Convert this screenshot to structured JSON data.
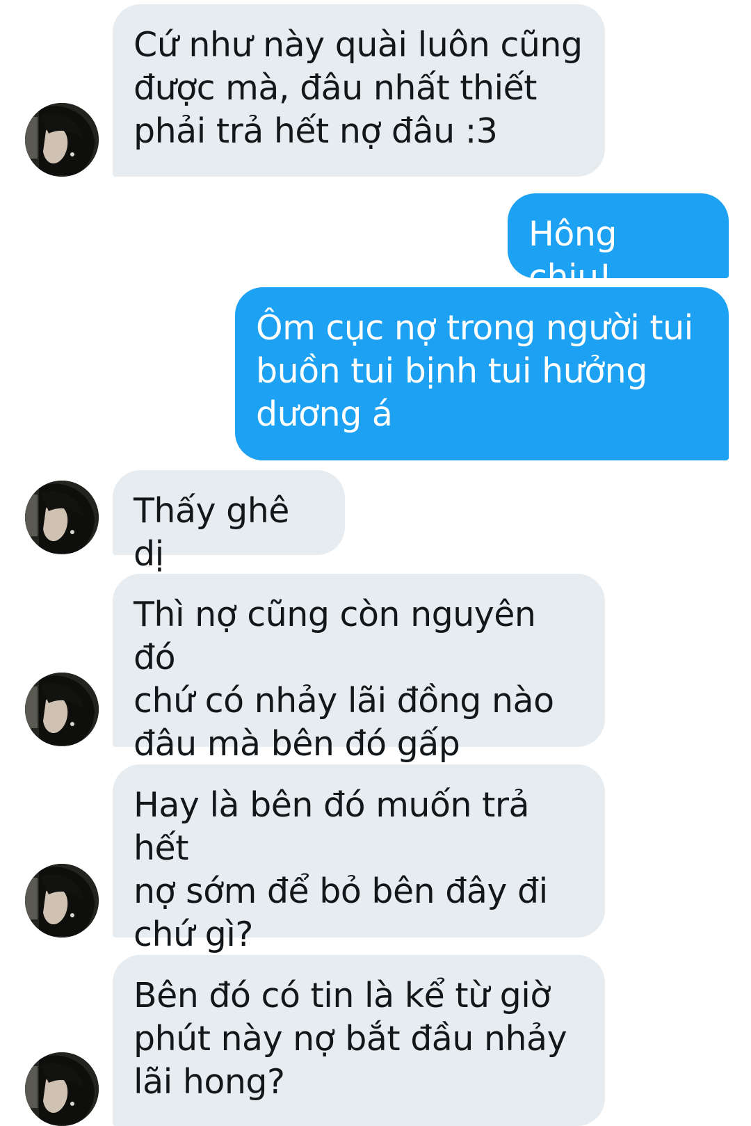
{
  "conversation": {
    "messages": [
      {
        "direction": "incoming",
        "text": "Cứ như này quài luôn cũng\nđược mà, đâu nhất thiết\nphải trả hết nợ đâu :3",
        "avatar": "contact-avatar"
      },
      {
        "direction": "outgoing",
        "text": "Hông chịu!"
      },
      {
        "direction": "outgoing",
        "text": "Ôm cục nợ trong người tui\nbuồn tui bịnh tui hưởng\ndương á"
      },
      {
        "direction": "incoming",
        "text": "Thấy ghê dị",
        "avatar": "contact-avatar"
      },
      {
        "direction": "incoming",
        "text": "Thì nợ cũng còn nguyên đó\nchứ có nhảy lãi đồng nào\nđâu mà bên đó gấp",
        "avatar": "contact-avatar"
      },
      {
        "direction": "incoming",
        "text": "Hay là bên đó muốn trả hết\nnợ sớm để bỏ bên đây đi\nchứ gì?",
        "avatar": "contact-avatar"
      },
      {
        "direction": "incoming",
        "text": "Bên đó có tin là kể từ giờ\nphút này nợ bắt đầu nhảy\nlãi hong?",
        "avatar": "contact-avatar"
      }
    ]
  },
  "colors": {
    "incoming_bubble": "#e6ecf0",
    "incoming_text": "#14171a",
    "outgoing_bubble": "#1da1f2",
    "outgoing_text": "#ffffff"
  }
}
